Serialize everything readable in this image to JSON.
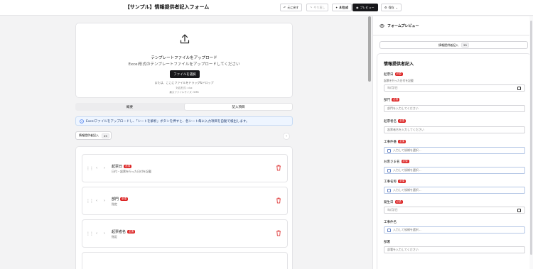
{
  "header": {
    "title": "【サンプル】情報提供者記入フォーム",
    "undo_label": "元に戻す",
    "redo_label": "やり直し",
    "ai_label": "AI生成",
    "preview_label": "プレビュー",
    "save_label": "保存"
  },
  "upload": {
    "title": "テンプレートファイルをアップロード",
    "subtitle": "Excel形式のテンプレートファイルをアップロードしてください",
    "button_label": "ファイルを選択",
    "drop_text": "または、ここにファイルをドラッグ&ドロップ",
    "format_text": "対応形式: xlsx",
    "max_size_text": "最大ファイルサイズ: 5MB"
  },
  "tabs": [
    {
      "label": "概要",
      "active": false
    },
    {
      "label": "記入項目",
      "active": true
    }
  ],
  "info_text": "Excelファイルをアップロードし、「シートを解析」ボタンを押すと、各シート毎に入力項目を自動で検出します。",
  "sheet": {
    "name": "情報提供者記入",
    "count": "25"
  },
  "fields": [
    {
      "name": "起票日",
      "required": "必須",
      "hint": "日付・起票を行った日付を記載"
    },
    {
      "name": "部門",
      "required": "必須",
      "hint": "指定"
    },
    {
      "name": "起票者名",
      "required": "必須",
      "hint": "指定"
    }
  ],
  "preview": {
    "title": "フォームプレビュー",
    "sheet_name": "情報提供者記入",
    "sheet_count": "25",
    "form_title": "情報提供者記入",
    "fields": [
      {
        "label": "起票日",
        "required": "必須",
        "hint": "起票を行った日付を記載",
        "placeholder": "年/月/日",
        "kind": "date"
      },
      {
        "label": "部門",
        "required": "必須",
        "placeholder": "部門を入力してください",
        "kind": "text"
      },
      {
        "label": "起票者名",
        "required": "必須",
        "placeholder": "起票者名を入力してください",
        "kind": "text"
      },
      {
        "label": "工事件番",
        "required": "必須",
        "placeholder": "入力して候補を選択...",
        "kind": "dropdown"
      },
      {
        "label": "お客さま名",
        "required": "必須",
        "placeholder": "入力して候補を選択...",
        "kind": "dropdown"
      },
      {
        "label": "工事名称",
        "required": "必須",
        "placeholder": "入力して候補を選択...",
        "kind": "dropdown"
      },
      {
        "label": "発生日",
        "required": "必須",
        "placeholder": "年/月/日",
        "kind": "date"
      },
      {
        "label": "工事件名",
        "required": "",
        "placeholder": "入力して候補を選択...",
        "kind": "dropdown"
      },
      {
        "label": "部署",
        "required": "",
        "placeholder": "部署を入力してください",
        "kind": "text"
      }
    ]
  }
}
